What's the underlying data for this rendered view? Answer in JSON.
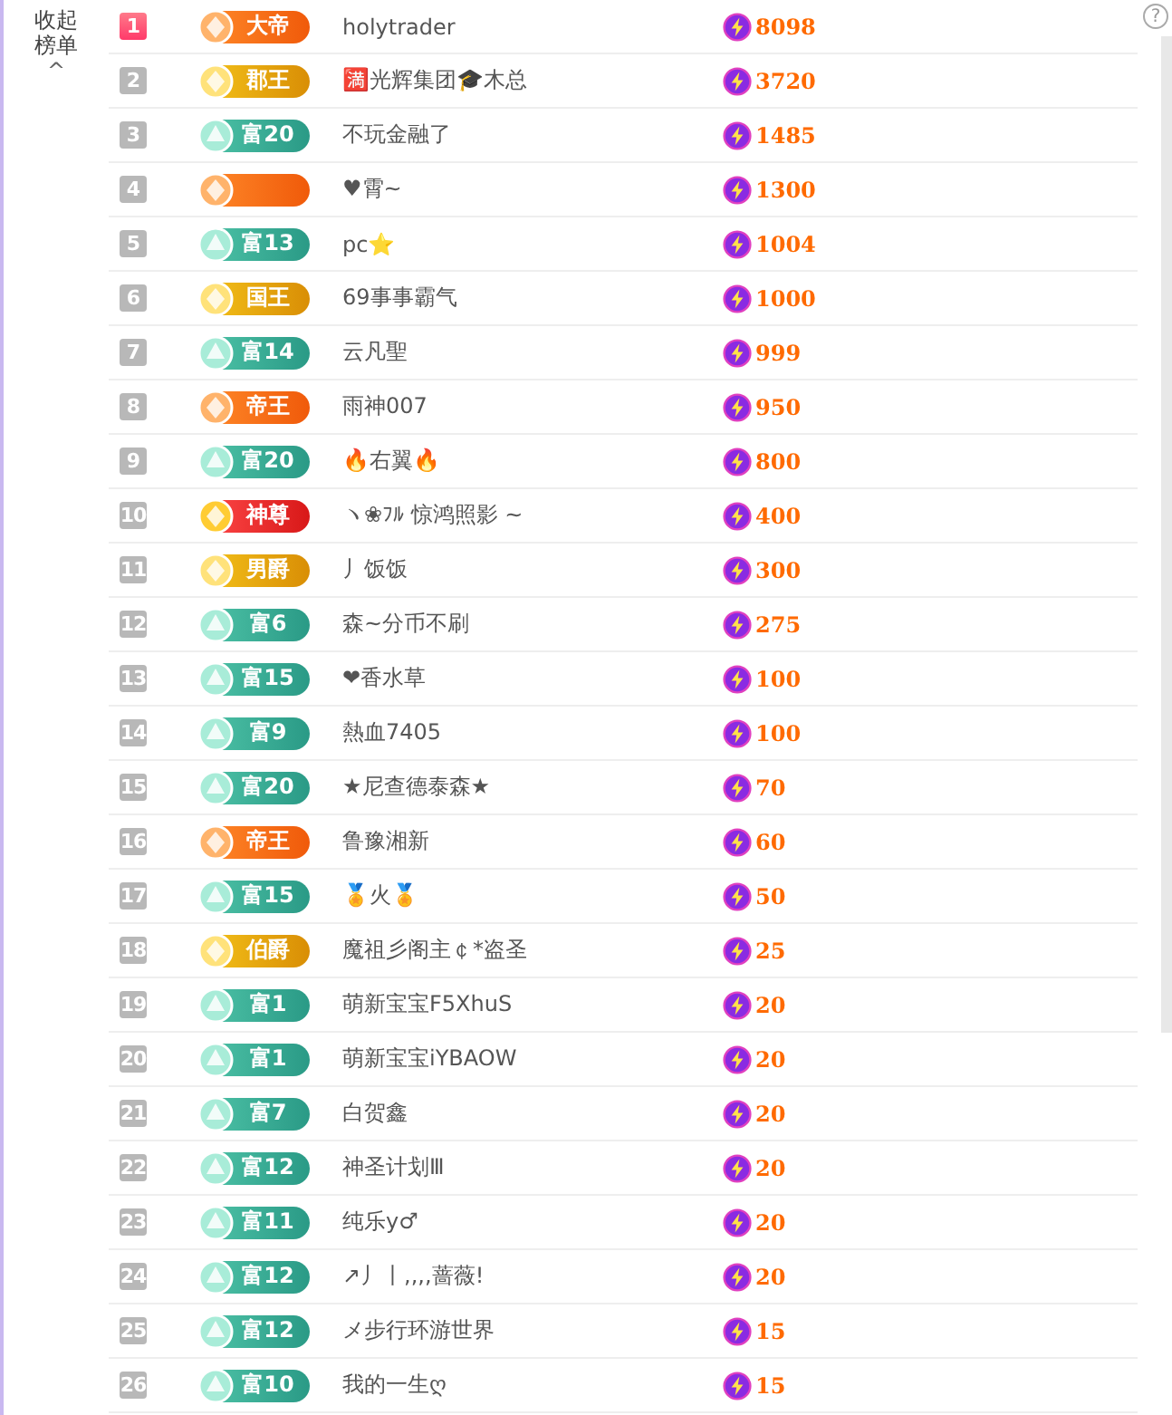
{
  "sidebar": {
    "collapse_label": "收起榜单",
    "caret": "^"
  },
  "rows": [
    {
      "rank": "1",
      "top": true,
      "badge": {
        "kind": "orange",
        "label": "大帝"
      },
      "name": "holytrader",
      "score": "8098"
    },
    {
      "rank": "2",
      "top": false,
      "badge": {
        "kind": "gold",
        "label": "郡王"
      },
      "name": "🈵光辉集团🎓木总",
      "score": "3720"
    },
    {
      "rank": "3",
      "top": false,
      "badge": {
        "kind": "green",
        "label": "富20"
      },
      "name": "不玩金融了",
      "score": "1485"
    },
    {
      "rank": "4",
      "top": false,
      "badge": {
        "kind": "orange"
      },
      "name": "♥霄~",
      "score": "1300"
    },
    {
      "rank": "5",
      "top": false,
      "badge": {
        "kind": "green",
        "label": "富13"
      },
      "name": "pc⭐",
      "score": "1004"
    },
    {
      "rank": "6",
      "top": false,
      "badge": {
        "kind": "gold",
        "label": "国王"
      },
      "name": "69事事霸气",
      "score": "1000"
    },
    {
      "rank": "7",
      "top": false,
      "badge": {
        "kind": "green",
        "label": "富14"
      },
      "name": "云凡聖",
      "score": "999"
    },
    {
      "rank": "8",
      "top": false,
      "badge": {
        "kind": "orange",
        "label": "帝王"
      },
      "name": "雨神007",
      "score": "950"
    },
    {
      "rank": "9",
      "top": false,
      "badge": {
        "kind": "green",
        "label": "富20"
      },
      "name": "🔥右翼🔥",
      "score": "800"
    },
    {
      "rank": "10",
      "top": false,
      "badge": {
        "kind": "red",
        "label": "神尊"
      },
      "name": "ヽ❀ﾌﾙ 惊鸿照影 ~",
      "score": "400"
    },
    {
      "rank": "11",
      "top": false,
      "badge": {
        "kind": "gold",
        "label": "男爵"
      },
      "name": "丿饭饭",
      "score": "300"
    },
    {
      "rank": "12",
      "top": false,
      "badge": {
        "kind": "green",
        "label": "富6"
      },
      "name": "森~分币不刷",
      "score": "275"
    },
    {
      "rank": "13",
      "top": false,
      "badge": {
        "kind": "green",
        "label": "富15"
      },
      "name": "❤香水草",
      "score": "100"
    },
    {
      "rank": "14",
      "top": false,
      "badge": {
        "kind": "green",
        "label": "富9"
      },
      "name": "熱血7405",
      "score": "100"
    },
    {
      "rank": "15",
      "top": false,
      "badge": {
        "kind": "green",
        "label": "富20"
      },
      "name": "★尼查德泰森★",
      "score": "70"
    },
    {
      "rank": "16",
      "top": false,
      "badge": {
        "kind": "orange",
        "label": "帝王"
      },
      "name": "鲁豫湘新",
      "score": "60"
    },
    {
      "rank": "17",
      "top": false,
      "badge": {
        "kind": "green",
        "label": "富15"
      },
      "name": "🏅火🏅",
      "score": "50"
    },
    {
      "rank": "18",
      "top": false,
      "badge": {
        "kind": "gold",
        "label": "伯爵"
      },
      "name": "魔祖彡阁主￠*盗圣",
      "score": "25"
    },
    {
      "rank": "19",
      "top": false,
      "badge": {
        "kind": "green",
        "label": "富1"
      },
      "name": "萌新宝宝F5XhuS",
      "score": "20"
    },
    {
      "rank": "20",
      "top": false,
      "badge": {
        "kind": "green",
        "label": "富1"
      },
      "name": "萌新宝宝iYBAOW",
      "score": "20"
    },
    {
      "rank": "21",
      "top": false,
      "badge": {
        "kind": "green",
        "label": "富7"
      },
      "name": "白贺鑫",
      "score": "20"
    },
    {
      "rank": "22",
      "top": false,
      "badge": {
        "kind": "green",
        "label": "富12"
      },
      "name": "神圣计划Ⅲ",
      "score": "20"
    },
    {
      "rank": "23",
      "top": false,
      "badge": {
        "kind": "green",
        "label": "富11"
      },
      "name": "纯乐y♂",
      "score": "20"
    },
    {
      "rank": "24",
      "top": false,
      "badge": {
        "kind": "green",
        "label": "富12"
      },
      "name": "↗丿丨,,,,蔷薇!",
      "score": "20"
    },
    {
      "rank": "25",
      "top": false,
      "badge": {
        "kind": "green",
        "label": "富12"
      },
      "name": "メ步行环游世界",
      "score": "15"
    },
    {
      "rank": "26",
      "top": false,
      "badge": {
        "kind": "green",
        "label": "富10"
      },
      "name": "我的一生ღ",
      "score": "15"
    }
  ],
  "help": {
    "symbol": "?"
  }
}
